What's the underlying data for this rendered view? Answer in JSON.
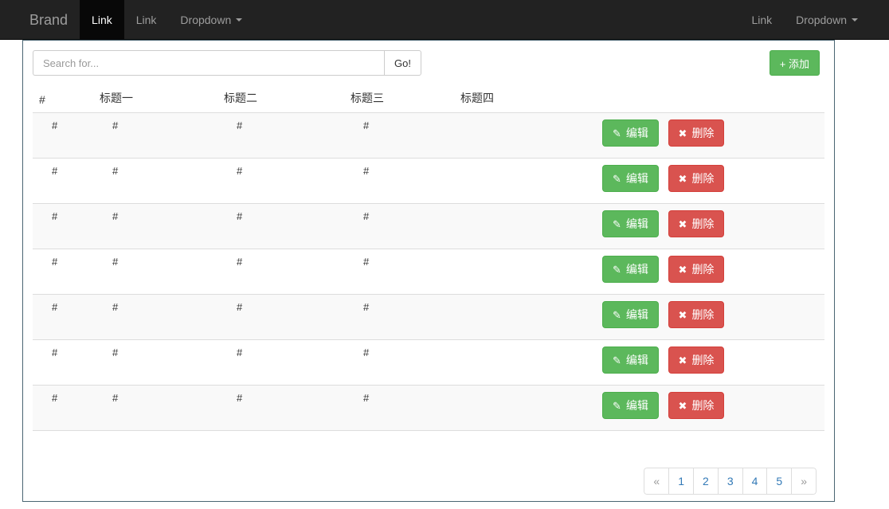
{
  "navbar": {
    "brand": "Brand",
    "left_items": [
      {
        "label": "Link",
        "active": true,
        "dropdown": false
      },
      {
        "label": "Link",
        "active": false,
        "dropdown": false
      },
      {
        "label": "Dropdown",
        "active": false,
        "dropdown": true
      }
    ],
    "right_items": [
      {
        "label": "Link",
        "active": false,
        "dropdown": false
      },
      {
        "label": "Dropdown",
        "active": false,
        "dropdown": true
      }
    ],
    "background_color": "#222222",
    "active_background_color": "#080808",
    "text_color": "#9d9d9d"
  },
  "toolbar": {
    "search_placeholder": "Search for...",
    "search_value": "",
    "go_label": "Go!",
    "add_label": "+ 添加",
    "add_color": "#5cb85c"
  },
  "table": {
    "headers": [
      "#",
      "标题一",
      "标题二",
      "标题三",
      "标题四",
      ""
    ],
    "rows": [
      {
        "cells": [
          "#",
          "#",
          "#",
          "#"
        ],
        "edit_label": "编辑",
        "delete_label": "删除"
      },
      {
        "cells": [
          "#",
          "#",
          "#",
          "#"
        ],
        "edit_label": "编辑",
        "delete_label": "删除"
      },
      {
        "cells": [
          "#",
          "#",
          "#",
          "#"
        ],
        "edit_label": "编辑",
        "delete_label": "删除"
      },
      {
        "cells": [
          "#",
          "#",
          "#",
          "#"
        ],
        "edit_label": "编辑",
        "delete_label": "删除"
      },
      {
        "cells": [
          "#",
          "#",
          "#",
          "#"
        ],
        "edit_label": "编辑",
        "delete_label": "删除"
      },
      {
        "cells": [
          "#",
          "#",
          "#",
          "#"
        ],
        "edit_label": "编辑",
        "delete_label": "删除"
      },
      {
        "cells": [
          "#",
          "#",
          "#",
          "#"
        ],
        "edit_label": "编辑",
        "delete_label": "删除"
      }
    ],
    "edit_color": "#5cb85c",
    "delete_color": "#d9534f",
    "edit_icon": "pencil-icon",
    "delete_icon": "cross-icon",
    "stripe_color": "#f9f9f9"
  },
  "pagination": {
    "items": [
      "«",
      "1",
      "2",
      "3",
      "4",
      "5",
      "»"
    ],
    "link_color": "#337ab7"
  }
}
